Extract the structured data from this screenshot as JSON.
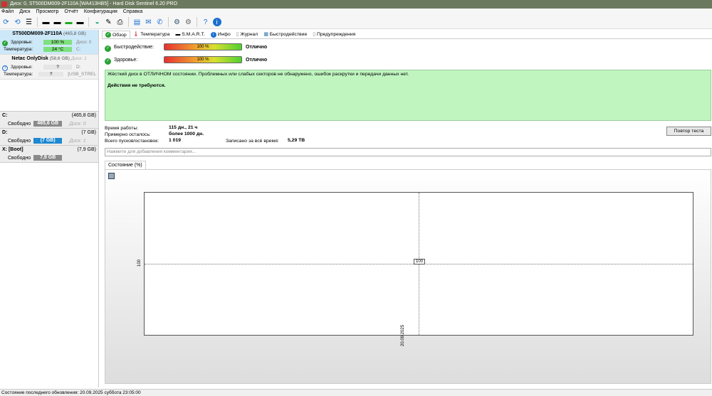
{
  "title": "Диск: 0, ST500DM009-2F110A [WA413HB5]  -  Hard Disk Sentinel 6.20 PRO",
  "menu": [
    "Файл",
    "Диск",
    "Просмотр",
    "Отчёт",
    "Конфигурация",
    "Справка"
  ],
  "disks": [
    {
      "name": "ST500DM009-2F110A",
      "size": "(465,8 GB)",
      "health_label": "Здоровье:",
      "health": "100 %",
      "health_pct": 100,
      "disk_id": "Диск: 0",
      "temp_label": "Температура:",
      "temp": "24 °C",
      "drive": "C:"
    },
    {
      "name": "Netac   OnlyDisk",
      "size": "(58,6 GB)",
      "disk_id": "Диск: 1",
      "health_label": "Здоровье:",
      "health": "?",
      "drive": "D:",
      "temp_label": "Температура:",
      "temp": "?",
      "extra": "[USB_STREL"
    }
  ],
  "volumes": [
    {
      "name": "C:",
      "size": "(465,8 GB)",
      "free_label": "Свободно",
      "free": "465,6 GB",
      "disk": "Диск: 0",
      "color": "#8a8a8a"
    },
    {
      "name": "D:",
      "size": "(7 GB)",
      "free_label": "Свободно",
      "free": "(7 GB)",
      "disk": "Диск: 1",
      "color": "#1e88d0"
    },
    {
      "name": "X: [Boot]",
      "size": "(7,9 GB)",
      "free_label": "Свободно",
      "free": "7,9 GB",
      "disk": "",
      "color": "#8a8a8a"
    }
  ],
  "tabs": [
    "Обзор",
    "Температура",
    "S.M.A.R.T.",
    "Инфо",
    "Журнал",
    "Быстродействие",
    "Предупреждения"
  ],
  "performance": {
    "label": "Быстродействие:",
    "value": "100 %",
    "pct": 100,
    "rating": "Отлично"
  },
  "health": {
    "label": "Здоровье:",
    "value": "100 %",
    "pct": 100,
    "rating": "Отлично"
  },
  "note": {
    "text": "Жёсткий диск в ОТЛИЧНОМ состоянии. Проблемных или слабых секторов не обнаружено, ошибок раскрутки и передачи данных нет.",
    "action": "Действия не требуются."
  },
  "stats": {
    "uptime_label": "Время работы:",
    "uptime": "115 дн., 21 ч",
    "remaining_label": "Примерно осталось:",
    "remaining": "более 1000 дн.",
    "starts_label": "Всего пусков/остановок:",
    "starts": "1 019",
    "written_label": "Записано за всё время:",
    "written": "5,29 TB"
  },
  "retest_label": "Повтор теста",
  "comment_placeholder": "Нажмите для добавления комментария...",
  "chart_tab": "Состояние (%)",
  "chart_data": {
    "type": "line",
    "x": [
      "20.09.2025"
    ],
    "values": [
      100
    ],
    "ylabel_tick": "100",
    "point_label": "100"
  },
  "status": "Состояние последнего обновления: 20.09.2025 суббота 23:05:00"
}
